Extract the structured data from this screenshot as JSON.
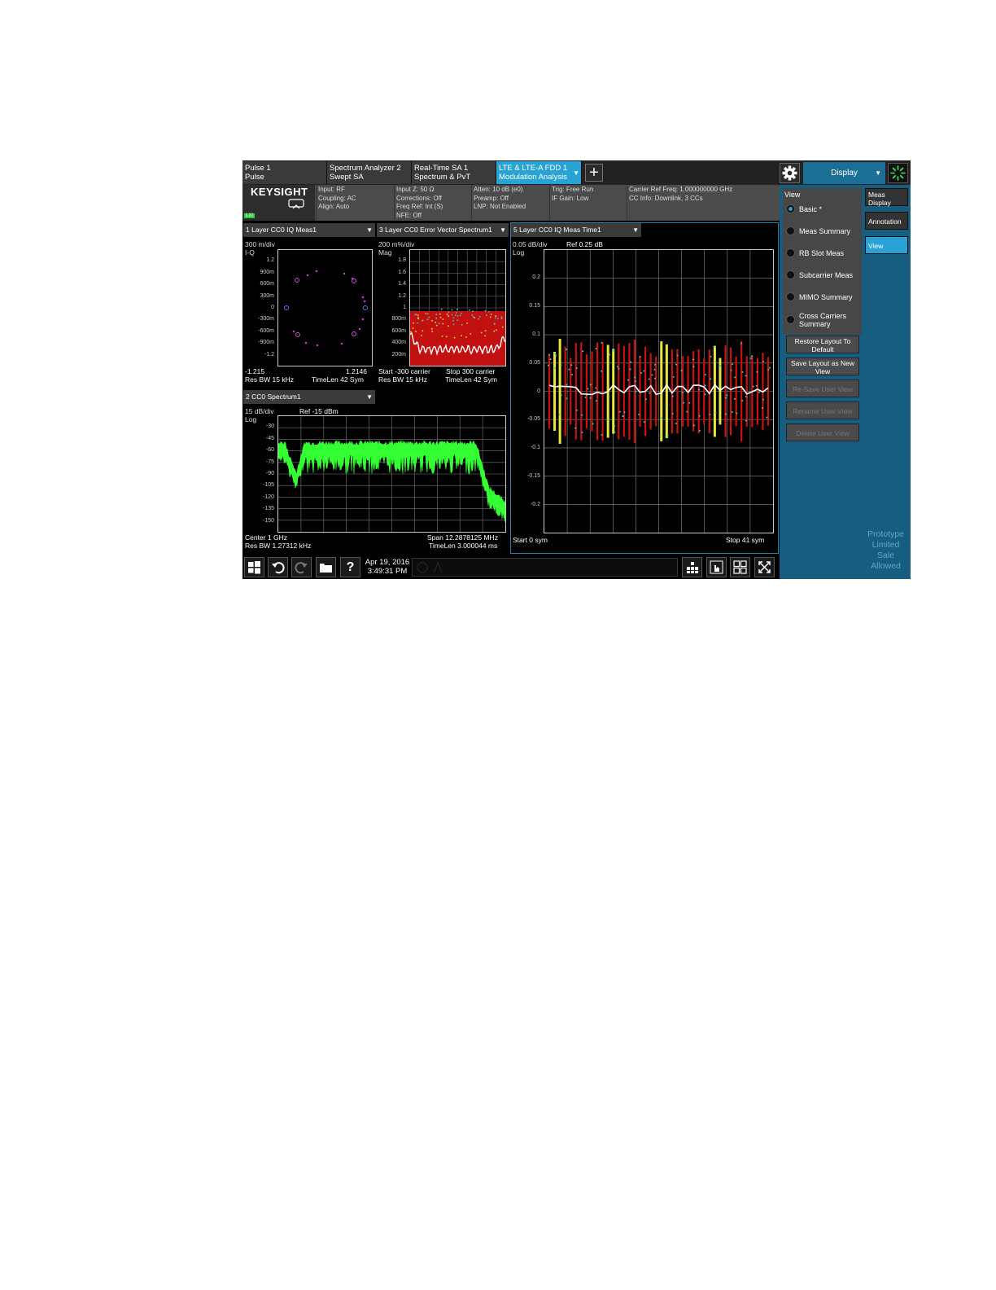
{
  "tabs": [
    {
      "l1": "Pulse 1",
      "l2": "Pulse"
    },
    {
      "l1": "Spectrum Analyzer 2",
      "l2": "Swept SA"
    },
    {
      "l1": "Real-Time SA 1",
      "l2": "Spectrum & PvT"
    },
    {
      "l1": "LTE & LTE-A FDD 1",
      "l2": "Modulation Analysis"
    }
  ],
  "add_tab": "+",
  "display_label": "Display",
  "dropdown_glyph": "▼",
  "brand": "KEYSIGHT",
  "lxi": "LXI",
  "info": {
    "c1": [
      "Input: RF",
      "Coupling: AC",
      "Align: Auto"
    ],
    "c2": [
      "Input Z: 50 Ω",
      "Corrections: Off",
      "Freq Ref: Int (S)",
      "NFE: Off"
    ],
    "c3": [
      "Atten: 10 dB (e0)",
      "Preamp: Off",
      "LNP: Not Enabled"
    ],
    "c4": [
      "Trig: Free Run",
      "IF Gain: Low"
    ],
    "c5": [
      "Carrier Ref Freq: 1.000000000 GHz",
      "CC Info: Downlink, 3 CCs"
    ]
  },
  "w1": {
    "title": "1 Layer CC0 IQ Meas1",
    "scale": "300 m/div",
    "unit": "I-Q",
    "yticks": [
      "1.2",
      "900m",
      "600m",
      "300m",
      "0",
      "-300m",
      "-600m",
      "-900m",
      "-1.2"
    ],
    "xmin": "-1.215",
    "xmax": "1.2146",
    "f1": "Res BW 15 kHz",
    "f2": "TimeLen 42  Sym"
  },
  "w3": {
    "title": "3 Layer CC0 Error Vector Spectrum1",
    "scale": "200 m%/div",
    "unit": "Mag",
    "yticks": [
      "1.8",
      "1.6",
      "1.4",
      "1.2",
      "1",
      "800m",
      "600m",
      "400m",
      "200m"
    ],
    "start": "Start -300  carrier",
    "stop": "Stop 300  carrier",
    "f1": "Res BW 15 kHz",
    "f2": "TimeLen 42  Sym"
  },
  "w2": {
    "title": "2 CC0 Spectrum1",
    "scale": "15 dB/div",
    "ref": "Ref -15 dBm",
    "unit": "Log",
    "yticks": [
      "-30",
      "-45",
      "-60",
      "-75",
      "-90",
      "-105",
      "-120",
      "-135",
      "-150"
    ],
    "center": "Center 1 GHz",
    "span": "Span 12.2878125 MHz",
    "rbw": "Res BW 1.27312 kHz",
    "tl": "TimeLen 3.000044 ms"
  },
  "w5": {
    "title": "5 Layer CC0 IQ Meas Time1",
    "scale": "0.05 dB/div",
    "ref": "Ref 0.25 dB",
    "unit": "Log",
    "yticks": [
      "0.2",
      "0.15",
      "0.1",
      "0.05",
      "0",
      "-0.05",
      "-0.1",
      "-0.15",
      "-0.2"
    ],
    "start": "Start 0  sym",
    "stop": "Stop 41  sym"
  },
  "side": {
    "view_label": "View",
    "options": [
      "Basic *",
      "Meas Summary",
      "RB Slot Meas",
      "Subcarrier Meas",
      "MIMO Summary",
      "Cross Carriers Summary"
    ],
    "buttons": [
      {
        "text": "Restore Layout To Default",
        "enabled": true
      },
      {
        "text": "Save Layout as New View",
        "enabled": true
      },
      {
        "text": "Re-Save User View",
        "enabled": false
      },
      {
        "text": "Rename User View",
        "enabled": false
      },
      {
        "text": "Delete User View",
        "enabled": false
      }
    ],
    "right_tabs": [
      "Meas Display",
      "Annotation",
      "View"
    ],
    "prototype": [
      "Prototype",
      "Limited",
      "Sale",
      "Allowed"
    ]
  },
  "taskbar": {
    "help": "?",
    "date": "Apr 19, 2016",
    "time": "3:49:31 PM"
  },
  "colors": {
    "accent": "#29a3d6",
    "spectrum": "#33ff33",
    "evm_band": "#cc1111",
    "trace_yellow": "#e8e83a",
    "trace_cyan": "#33cccc"
  }
}
